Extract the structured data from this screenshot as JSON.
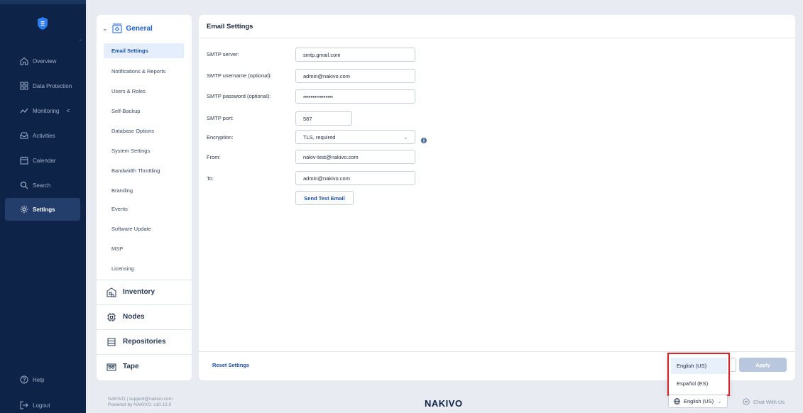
{
  "nav": {
    "items": [
      {
        "label": "Overview",
        "icon": "home-icon"
      },
      {
        "label": "Data Protection",
        "icon": "grid-icon"
      },
      {
        "label": "Monitoring",
        "icon": "chart-line-icon"
      },
      {
        "label": "Activities",
        "icon": "inbox-icon"
      },
      {
        "label": "Calendar",
        "icon": "calendar-icon"
      },
      {
        "label": "Search",
        "icon": "search-icon"
      },
      {
        "label": "Settings",
        "icon": "gear-icon"
      }
    ],
    "help": "Help",
    "logout": "Logout",
    "monitoring_chevron": "<"
  },
  "settings_nav": {
    "section": "General",
    "items": [
      "Email Settings",
      "Notifications & Reports",
      "Users & Roles",
      "Self-Backup",
      "Database Options",
      "System Settings",
      "Bandwidth Throttling",
      "Branding",
      "Events",
      "Software Update",
      "MSP",
      "Licensing"
    ],
    "groups": [
      "Inventory",
      "Nodes",
      "Repositories",
      "Tape"
    ]
  },
  "email_settings": {
    "title": "Email Settings",
    "smtp_server_label": "SMTP server:",
    "smtp_server_value": "smtp.gmail.com",
    "smtp_username_label": "SMTP username (optional):",
    "smtp_username_value": "admin@nakivo.com",
    "smtp_password_label": "SMTP password (optional):",
    "smtp_password_value": "••••••••••••••••",
    "smtp_port_label": "SMTP port:",
    "smtp_port_value": "587",
    "encryption_label": "Encryption:",
    "encryption_value": "TLS, required",
    "from_label": "From:",
    "from_value": "nakiv-test@nakivo.com",
    "to_label": "To:",
    "to_value": "admin@nakivo.com",
    "send_test_label": "Send Test Email",
    "reset_label": "Reset Settings",
    "apply_label": "Apply"
  },
  "language_menu": {
    "options": [
      "English (US)",
      "Español (ES)"
    ],
    "selected": "English (US)"
  },
  "footer": {
    "copyright_line1": "NAKIVO | support@nakivo.com",
    "copyright_line2": "Powered by NAKIVO. v10.12.0",
    "brand": "NAKIVO",
    "language": "English (US)",
    "chat": "Chat With Us"
  },
  "colors": {
    "nav_bg": "#0d2347",
    "accent": "#1a5fd0",
    "highlight_border": "#d8202a"
  }
}
